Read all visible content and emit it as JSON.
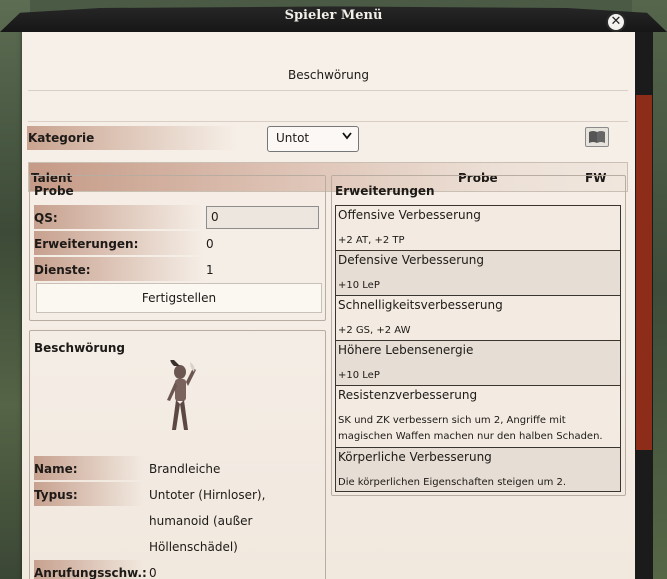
{
  "window": {
    "title": "Spieler Menü",
    "close_symbol": "✕"
  },
  "heading": "Beschwörung",
  "category": {
    "label": "Kategorie",
    "selected": "Untot"
  },
  "icons": {
    "book": "book-icon",
    "close": "close-icon",
    "chevron": "chevron-down-icon"
  },
  "talent_table": {
    "col_talent": "Talent",
    "col_probe": "Probe",
    "col_fw": "FW"
  },
  "probe_panel": {
    "title": "Probe",
    "qs_label": "QS:",
    "qs_value": "0",
    "erw_label": "Erweiterungen:",
    "erw_value": "0",
    "dienste_label": "Dienste:",
    "dienste_value": "1",
    "button": "Fertigstellen"
  },
  "extensions": {
    "title": "Erweiterungen",
    "items": [
      {
        "name": "Offensive Verbesserung",
        "desc": "+2 AT, +2 TP"
      },
      {
        "name": "Defensive Verbesserung",
        "desc": "+10 LeP"
      },
      {
        "name": "Schnelligkeitsverbesserung",
        "desc": "+2 GS, +2 AW"
      },
      {
        "name": "Höhere Lebensenergie",
        "desc": "+10 LeP"
      },
      {
        "name": "Resistenzverbesserung",
        "desc": "SK und ZK verbessern sich um 2, Angriffe mit magischen Waffen machen nur den halben Schaden."
      },
      {
        "name": "Körperliche Verbesserung",
        "desc": "Die körperlichen Eigenschaften steigen um 2."
      }
    ]
  },
  "summon_panel": {
    "title": "Beschwörung",
    "name_label": "Name:",
    "name_value": "Brandleiche",
    "typ_label": "Typus:",
    "typ_line1": "Untoter (Hirnloser),",
    "typ_line2": "humanoid (außer",
    "typ_line3": "Höllenschädel)",
    "anruf_label": "Anrufungsschw.:",
    "anruf_value": "0"
  },
  "colors": {
    "accent_bar": "#c7a18f",
    "scroll_thumb": "#8e2c1a",
    "titlebar": "#1e1e1e"
  }
}
